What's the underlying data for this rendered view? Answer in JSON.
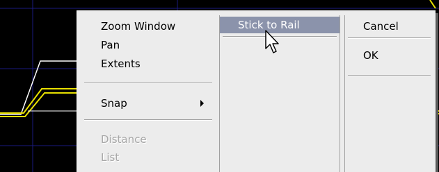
{
  "menu": {
    "column1": {
      "zoom_window": "Zoom Window",
      "pan": "Pan",
      "extents": "Extents",
      "snap": "Snap",
      "distance": "Distance",
      "list": "List"
    },
    "column2": {
      "stick_to_rail": "Stick to Rail"
    },
    "column3": {
      "cancel": "Cancel",
      "ok": "OK"
    }
  },
  "colors": {
    "background": "#000000",
    "grid": "#1a1a80",
    "rail_yellow": "#e8e000",
    "rail_white": "#ffffff",
    "menu_bg": "#ececec",
    "highlight": "#8b93ab"
  },
  "edge_text": "("
}
